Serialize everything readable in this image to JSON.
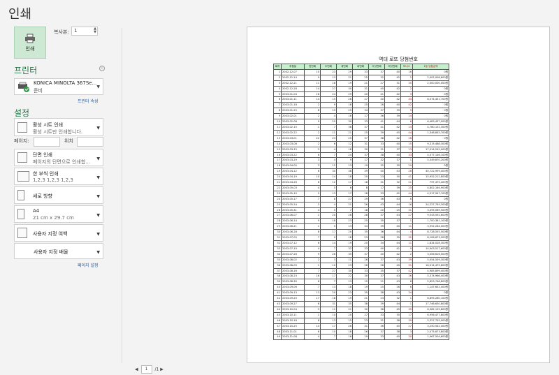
{
  "title": "인쇄",
  "print_button": {
    "label": "인쇄"
  },
  "copies": {
    "label": "복사본:",
    "value": "1"
  },
  "printer_section": {
    "title": "프린터",
    "name": "KONICA MINOLTA 367Se...",
    "status": "준비",
    "properties_link": "프린터 속성"
  },
  "settings_section": {
    "title": "설정"
  },
  "options": [
    {
      "line1": "활성 시트 인쇄",
      "line2": "활성 시트만 인쇄합니다."
    },
    {
      "line1": "단면 인쇄",
      "line2": "페이지의 단면으로 인쇄합..."
    },
    {
      "line1": "한 부씩 인쇄",
      "line2": "1,2,3    1,2,3    1,2,3"
    },
    {
      "line1": "세로 방향",
      "line2": ""
    },
    {
      "line1": "A4",
      "line2": "21 cm x 29.7 cm"
    },
    {
      "line1": "사용자 지정 여백",
      "line2": ""
    },
    {
      "line1": "사용자 지정 배율",
      "line2": ""
    }
  ],
  "pages": {
    "label": "페이지:",
    "to_label": "위치"
  },
  "page_setup_link": "페이지 설정",
  "pager": {
    "current": "1",
    "total": "/1"
  },
  "sheet": {
    "title": "역대 로또 당첨번호",
    "headers": [
      "회차",
      "추첨일",
      "첫번째",
      "두번째",
      "세번째",
      "네번째",
      "다섯번째",
      "여섯번째",
      "보너스",
      "1등 당첨금액"
    ],
    "rows": [
      [
        "1",
        "2002-12-07",
        "10",
        "23",
        "29",
        "33",
        "37",
        "40",
        "16",
        "0원"
      ],
      [
        "2",
        "2002-12-14",
        "9",
        "13",
        "21",
        "25",
        "32",
        "42",
        "2",
        "2,002,006,800원"
      ],
      [
        "3",
        "2002-12-21",
        "11",
        "16",
        "19",
        "21",
        "27",
        "31",
        "30",
        "2,000,000,000원"
      ],
      [
        "4",
        "2002-12-28",
        "14",
        "27",
        "30",
        "31",
        "40",
        "42",
        "2",
        "0원"
      ],
      [
        "5",
        "2003-01-04",
        "16",
        "24",
        "29",
        "40",
        "41",
        "42",
        "3",
        "0원"
      ],
      [
        "6",
        "2003-01-11",
        "14",
        "15",
        "26",
        "27",
        "40",
        "42",
        "34",
        "6,574,451,700원"
      ],
      [
        "7",
        "2003-01-18",
        "2",
        "9",
        "16",
        "25",
        "26",
        "40",
        "42",
        "0원"
      ],
      [
        "8",
        "2003-01-25",
        "8",
        "19",
        "25",
        "34",
        "37",
        "39",
        "9",
        "0원"
      ],
      [
        "9",
        "2003-02-01",
        "2",
        "4",
        "16",
        "17",
        "36",
        "39",
        "14",
        "0원"
      ],
      [
        "10",
        "2003-02-08",
        "9",
        "25",
        "30",
        "33",
        "41",
        "44",
        "6",
        "6,483,437,900원"
      ],
      [
        "11",
        "2003-02-15",
        "1",
        "7",
        "36",
        "37",
        "41",
        "42",
        "14",
        "4,780,152,300원"
      ],
      [
        "12",
        "2003-02-22",
        "2",
        "11",
        "21",
        "25",
        "39",
        "45",
        "44",
        "1,348,845,700원"
      ],
      [
        "13",
        "2003-03-01",
        "22",
        "23",
        "25",
        "37",
        "38",
        "42",
        "26",
        "0원"
      ],
      [
        "14",
        "2003-03-08",
        "2",
        "6",
        "12",
        "31",
        "33",
        "40",
        "15",
        "9,315,468,300원"
      ],
      [
        "15",
        "2003-03-15",
        "3",
        "4",
        "16",
        "30",
        "31",
        "37",
        "13",
        "17,014,245,000원"
      ],
      [
        "16",
        "2003-03-22",
        "6",
        "7",
        "24",
        "37",
        "38",
        "40",
        "33",
        "4,077,146,100원"
      ],
      [
        "17",
        "2003-03-29",
        "3",
        "4",
        "9",
        "17",
        "32",
        "37",
        "1",
        "5,349,870,200원"
      ],
      [
        "18",
        "2003-04-05",
        "3",
        "12",
        "13",
        "19",
        "32",
        "35",
        "29",
        "0원"
      ],
      [
        "19",
        "2003-04-12",
        "6",
        "30",
        "38",
        "39",
        "40",
        "43",
        "26",
        "40,722,959,400원"
      ],
      [
        "20",
        "2003-04-19",
        "10",
        "14",
        "18",
        "20",
        "23",
        "30",
        "41",
        "15,952,212,800원"
      ],
      [
        "21",
        "2003-04-26",
        "6",
        "12",
        "17",
        "18",
        "31",
        "32",
        "21",
        "797,475,400원"
      ],
      [
        "22",
        "2003-05-03",
        "4",
        "5",
        "6",
        "8",
        "17",
        "39",
        "25",
        "4,802,164,900원"
      ],
      [
        "23",
        "2003-05-10",
        "5",
        "13",
        "17",
        "18",
        "33",
        "42",
        "44",
        "4,517,947,700원"
      ],
      [
        "24",
        "2003-05-17",
        "7",
        "8",
        "27",
        "29",
        "36",
        "43",
        "6",
        "0원"
      ],
      [
        "25",
        "2003-05-24",
        "2",
        "4",
        "21",
        "26",
        "43",
        "44",
        "16",
        "24,227,745,300원"
      ],
      [
        "26",
        "2003-05-31",
        "4",
        "5",
        "7",
        "18",
        "20",
        "25",
        "31",
        "3,495,069,500원"
      ],
      [
        "27",
        "2003-06-07",
        "1",
        "20",
        "26",
        "28",
        "37",
        "43",
        "27",
        "9,543,592,600원"
      ],
      [
        "28",
        "2003-06-14",
        "9",
        "18",
        "23",
        "25",
        "35",
        "37",
        "1",
        "1,700,361,100원"
      ],
      [
        "29",
        "2003-06-21",
        "1",
        "5",
        "13",
        "34",
        "39",
        "40",
        "11",
        "3,952,284,000원"
      ],
      [
        "30",
        "2003-06-28",
        "8",
        "17",
        "20",
        "35",
        "36",
        "44",
        "4",
        "8,728,555,500원"
      ],
      [
        "31",
        "2003-07-05",
        "7",
        "9",
        "18",
        "23",
        "28",
        "35",
        "32",
        "8,106,673,900원"
      ],
      [
        "32",
        "2003-07-12",
        "6",
        "14",
        "19",
        "25",
        "34",
        "44",
        "11",
        "1,834,028,300원"
      ],
      [
        "33",
        "2003-07-19",
        "4",
        "7",
        "32",
        "33",
        "40",
        "41",
        "9",
        "14,903,517,600원"
      ],
      [
        "34",
        "2003-07-26",
        "9",
        "26",
        "35",
        "37",
        "40",
        "42",
        "2",
        "3,056,616,000원"
      ],
      [
        "35",
        "2003-08-02",
        "2",
        "3",
        "11",
        "26",
        "37",
        "43",
        "39",
        "5,054,559,300원"
      ],
      [
        "36",
        "2003-08-09",
        "1",
        "10",
        "23",
        "26",
        "28",
        "40",
        "31",
        "18,014,475,800원"
      ],
      [
        "37",
        "2003-08-16",
        "7",
        "27",
        "30",
        "33",
        "35",
        "37",
        "42",
        "4,985,899,400원"
      ],
      [
        "38",
        "2003-08-23",
        "16",
        "17",
        "22",
        "30",
        "37",
        "43",
        "36",
        "5,374,966,400원"
      ],
      [
        "39",
        "2003-08-30",
        "6",
        "7",
        "13",
        "15",
        "21",
        "43",
        "8",
        "2,823,748,800원"
      ],
      [
        "40",
        "2003-09-06",
        "7",
        "13",
        "18",
        "19",
        "25",
        "26",
        "6",
        "1,147,652,400원"
      ],
      [
        "41",
        "2003-09-13",
        "13",
        "20",
        "23",
        "35",
        "38",
        "43",
        "34",
        "0원"
      ],
      [
        "42",
        "2003-09-20",
        "17",
        "18",
        "19",
        "21",
        "23",
        "32",
        "1",
        "6,895,280,100원"
      ],
      [
        "43",
        "2003-09-27",
        "6",
        "31",
        "35",
        "38",
        "39",
        "44",
        "1",
        "17,746,630,800원"
      ],
      [
        "44",
        "2003-10-04",
        "3",
        "11",
        "21",
        "30",
        "38",
        "45",
        "39",
        "6,362,155,800원"
      ],
      [
        "45",
        "2003-10-11",
        "1",
        "10",
        "20",
        "27",
        "33",
        "35",
        "17",
        "6,956,477,800원"
      ],
      [
        "46",
        "2003-10-18",
        "8",
        "13",
        "15",
        "23",
        "31",
        "38",
        "39",
        "5,327,755,900원"
      ],
      [
        "47",
        "2003-10-25",
        "14",
        "17",
        "26",
        "31",
        "36",
        "45",
        "27",
        "3,250,542,400원"
      ],
      [
        "48",
        "2003-11-01",
        "6",
        "10",
        "18",
        "26",
        "37",
        "38",
        "3",
        "2,475,673,800원"
      ],
      [
        "49",
        "2003-11-08",
        "4",
        "7",
        "16",
        "19",
        "33",
        "40",
        "30",
        "1,967,504,600원"
      ]
    ]
  }
}
